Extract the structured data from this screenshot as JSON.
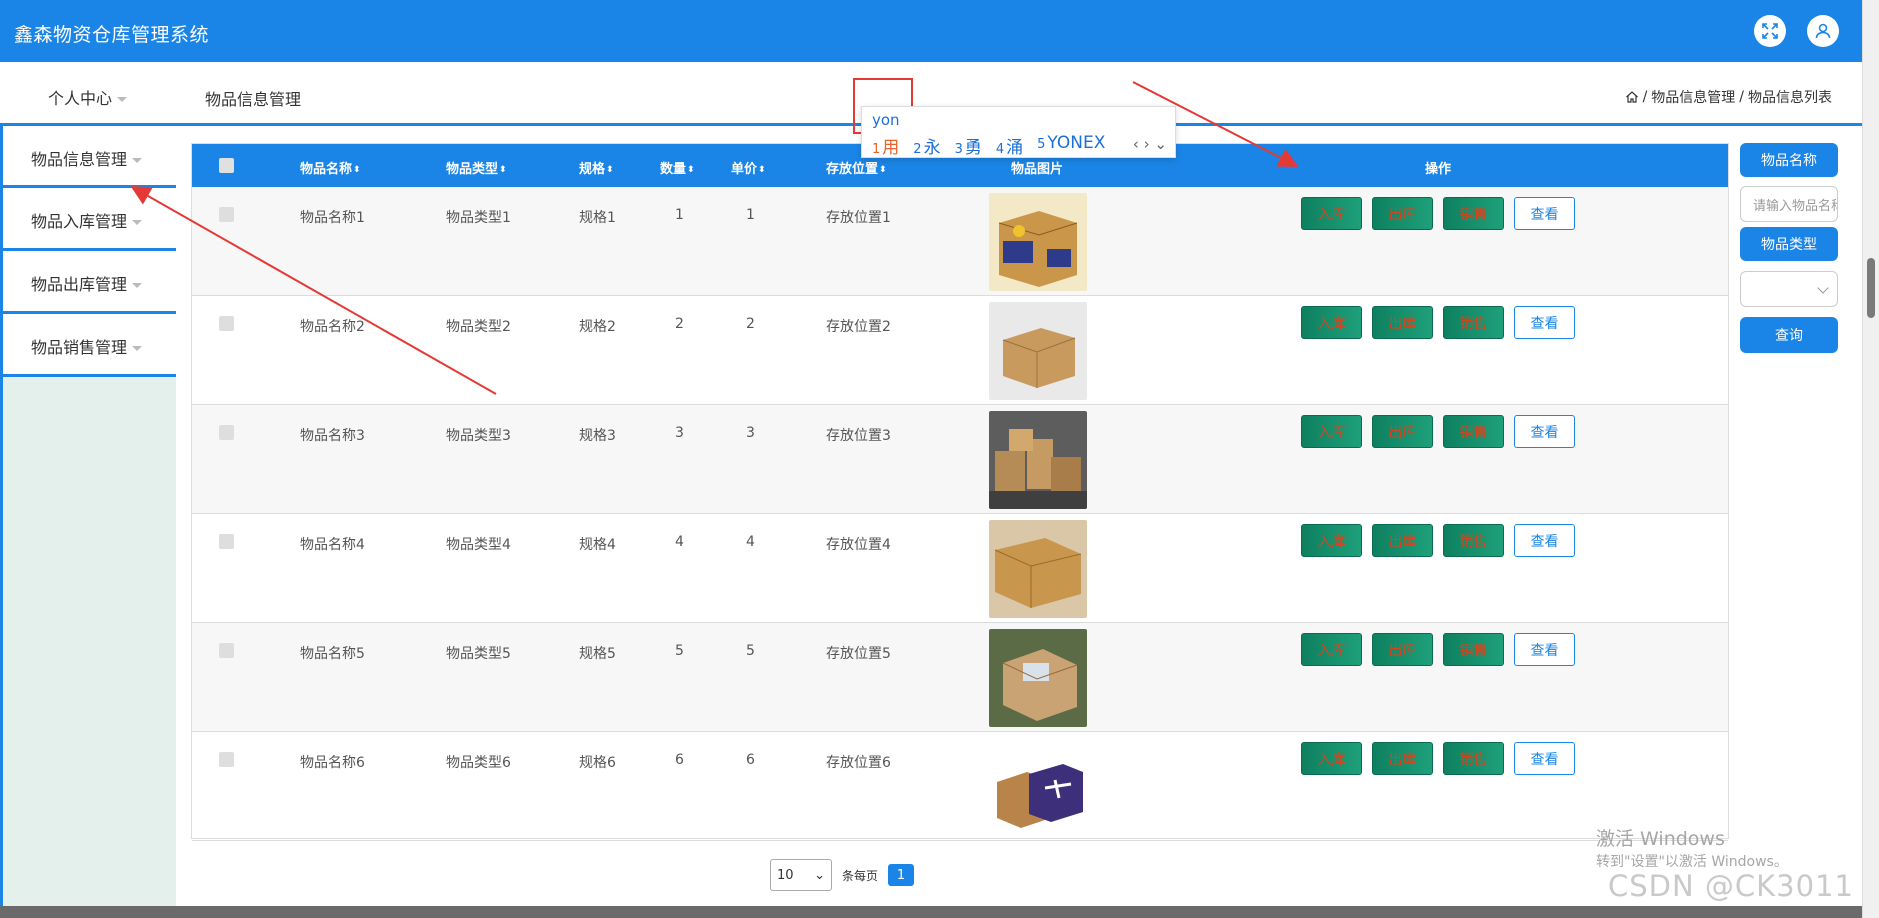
{
  "header": {
    "title": "鑫森物资仓库管理系统"
  },
  "topnav": {
    "personal_center": "个人中心",
    "current_page": "物品信息管理"
  },
  "breadcrumb": {
    "sep": "/",
    "level1": "物品信息管理",
    "level2": "物品信息列表"
  },
  "ime": {
    "composition": "yon",
    "candidates": [
      {
        "num": "1",
        "text": "用"
      },
      {
        "num": "2",
        "text": "永"
      },
      {
        "num": "3",
        "text": "勇"
      },
      {
        "num": "4",
        "text": "涌"
      },
      {
        "num": "5",
        "text": "YONEX"
      }
    ],
    "nav": "‹ › ⌄"
  },
  "sidebar": {
    "items": [
      {
        "label": "物品信息管理"
      },
      {
        "label": "物品入库管理"
      },
      {
        "label": "物品出库管理"
      },
      {
        "label": "物品销售管理"
      }
    ]
  },
  "table": {
    "headers": {
      "name": "物品名称",
      "type": "物品类型",
      "spec": "规格",
      "qty": "数量",
      "price": "单价",
      "location": "存放位置",
      "image": "物品图片",
      "actions": "操作"
    },
    "sort_glyph": "⬍",
    "action_labels": {
      "in": "入库",
      "out": "出库",
      "sale": "销售",
      "view": "查看"
    },
    "rows": [
      {
        "name": "物品名称1",
        "type": "物品类型1",
        "spec": "规格1",
        "qty": "1",
        "price": "1",
        "location": "存放位置1"
      },
      {
        "name": "物品名称2",
        "type": "物品类型2",
        "spec": "规格2",
        "qty": "2",
        "price": "2",
        "location": "存放位置2"
      },
      {
        "name": "物品名称3",
        "type": "物品类型3",
        "spec": "规格3",
        "qty": "3",
        "price": "3",
        "location": "存放位置3"
      },
      {
        "name": "物品名称4",
        "type": "物品类型4",
        "spec": "规格4",
        "qty": "4",
        "price": "4",
        "location": "存放位置4"
      },
      {
        "name": "物品名称5",
        "type": "物品类型5",
        "spec": "规格5",
        "qty": "5",
        "price": "5",
        "location": "存放位置5"
      },
      {
        "name": "物品名称6",
        "type": "物品类型6",
        "spec": "规格6",
        "qty": "6",
        "price": "6",
        "location": "存放位置6"
      }
    ]
  },
  "pager": {
    "page_size": "10",
    "per_page_label": "条每页",
    "current_page": "1"
  },
  "search": {
    "name_label": "物品名称",
    "name_placeholder": "请输入物品名称",
    "type_label": "物品类型",
    "type_value": "",
    "query_button": "查询"
  },
  "watermark": {
    "activate_title": "激活 Windows",
    "activate_sub": "转到\"设置\"以激活 Windows。",
    "csdn": "CSDN @CK3011"
  },
  "colors": {
    "primary": "#1a85e6",
    "action_green": "#138a66",
    "annotation_red": "#e53935"
  }
}
